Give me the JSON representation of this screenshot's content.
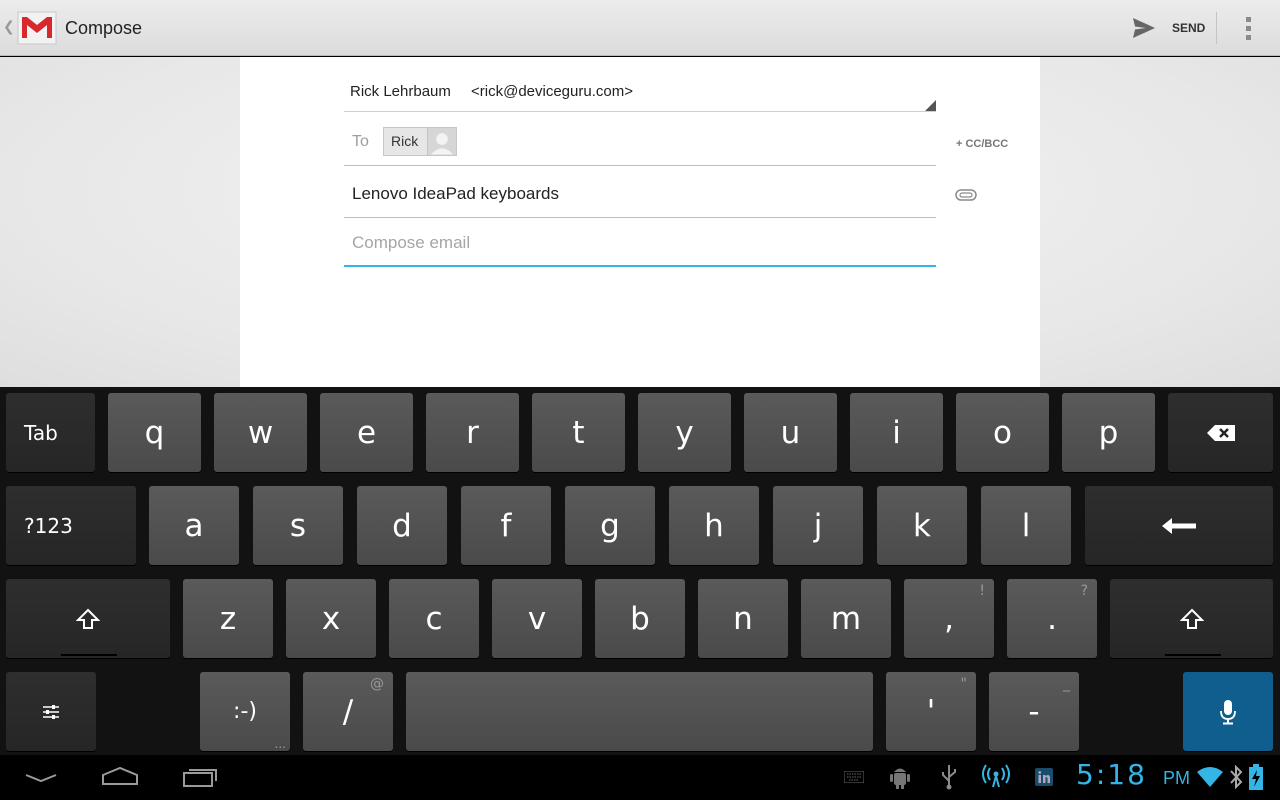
{
  "action_bar": {
    "title": "Compose",
    "send_label": "SEND"
  },
  "compose": {
    "from_name": "Rick Lehrbaum",
    "from_email": "<rick@deviceguru.com>",
    "to_label": "To",
    "recipient_chip": "Rick",
    "cc_bcc_label": "+ CC/BCC",
    "subject": "Lenovo IdeaPad keyboards",
    "body_placeholder": "Compose email"
  },
  "keyboard": {
    "row1": [
      "Tab",
      "q",
      "w",
      "e",
      "r",
      "t",
      "y",
      "u",
      "i",
      "o",
      "p"
    ],
    "row2": [
      "?123",
      "a",
      "s",
      "d",
      "f",
      "g",
      "h",
      "j",
      "k",
      "l"
    ],
    "row3": [
      "z",
      "x",
      "c",
      "v",
      "b",
      "n",
      "m",
      ",",
      "."
    ],
    "row3_hints": {
      "comma": "!",
      "period": "?"
    },
    "row4": [
      ":-)",
      "/",
      "'",
      "-"
    ],
    "row4_hints": {
      "smiley": "...",
      "slash": "@",
      "apostrophe": "\"",
      "dash": "_"
    },
    "icons": [
      "backspace-icon",
      "enter-icon",
      "shift-icon",
      "settings-icon",
      "mic-icon"
    ],
    "mic_color": "#0f5e8e"
  },
  "system_bar": {
    "time": "5:18",
    "ampm": "PM",
    "accent_color": "#33b5e5",
    "icons": [
      "back-icon",
      "home-icon",
      "recent-apps-icon",
      "keyboard-icon",
      "android-debug-icon",
      "usb-icon",
      "hotspot-icon",
      "linkedin-icon",
      "wifi-icon",
      "bluetooth-icon",
      "battery-icon"
    ]
  }
}
